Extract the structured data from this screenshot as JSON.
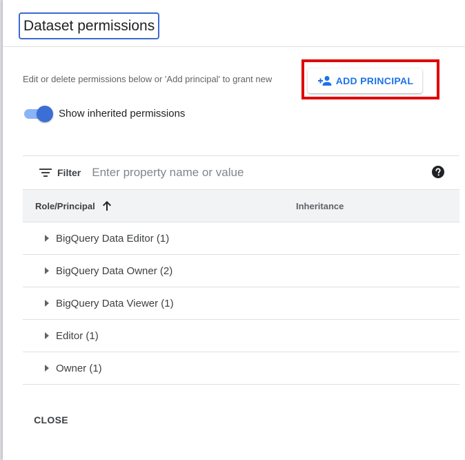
{
  "dialog": {
    "title": "Dataset permissions",
    "help_text": "Edit or delete permissions below or 'Add principal' to grant new",
    "add_principal_label": "ADD PRINCIPAL",
    "show_inherited_label": "Show inherited permissions",
    "show_inherited_on": true,
    "close_label": "CLOSE"
  },
  "filter": {
    "label": "Filter",
    "placeholder": "Enter property name or value",
    "value": ""
  },
  "table": {
    "columns": {
      "role": "Role/Principal",
      "inheritance": "Inheritance"
    },
    "rows": [
      {
        "label": "BigQuery Data Editor (1)"
      },
      {
        "label": "BigQuery Data Owner (2)"
      },
      {
        "label": "BigQuery Data Viewer (1)"
      },
      {
        "label": "Editor (1)"
      },
      {
        "label": "Owner (1)"
      }
    ]
  },
  "colors": {
    "accent": "#1a73e8",
    "highlight": "#e00000",
    "toggle_knob": "#3b6fd6"
  },
  "icons": {
    "add_principal": "person-add-icon",
    "filter": "filter-icon",
    "help": "help-icon",
    "sort": "arrow-up-icon",
    "expand": "caret-right-icon"
  }
}
